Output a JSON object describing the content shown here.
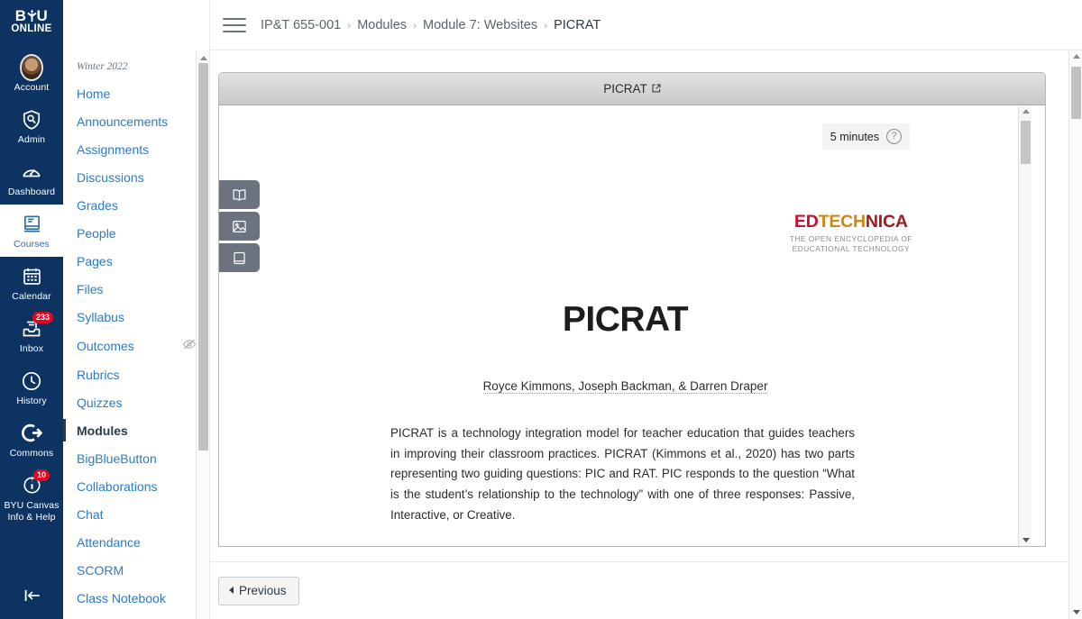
{
  "global_nav": {
    "logo": {
      "line1_pre": "B",
      "line1_mid": "Y",
      "line1_post": "U",
      "line2": "ONLINE"
    },
    "items": [
      {
        "label": "Account",
        "icon": "avatar-icon",
        "badge": null,
        "active": false
      },
      {
        "label": "Admin",
        "icon": "shield-wrench-icon",
        "badge": null,
        "active": false
      },
      {
        "label": "Dashboard",
        "icon": "dashboard-gauge-icon",
        "badge": null,
        "active": false
      },
      {
        "label": "Courses",
        "icon": "courses-book-icon",
        "badge": null,
        "active": true
      },
      {
        "label": "Calendar",
        "icon": "calendar-icon",
        "badge": null,
        "active": false
      },
      {
        "label": "Inbox",
        "icon": "inbox-tray-icon",
        "badge": "233",
        "active": false
      },
      {
        "label": "History",
        "icon": "clock-icon",
        "badge": null,
        "active": false
      },
      {
        "label": "Commons",
        "icon": "commons-arrow-icon",
        "badge": null,
        "active": false
      },
      {
        "label": "BYU Canvas Info & Help",
        "icon": "help-info-icon",
        "badge": "10",
        "active": false
      }
    ],
    "collapse_icon": "collapse-left-icon"
  },
  "course_nav": {
    "term": "Winter 2022",
    "items": [
      {
        "label": "Home",
        "active": false,
        "hidden": false
      },
      {
        "label": "Announcements",
        "active": false,
        "hidden": false
      },
      {
        "label": "Assignments",
        "active": false,
        "hidden": false
      },
      {
        "label": "Discussions",
        "active": false,
        "hidden": false
      },
      {
        "label": "Grades",
        "active": false,
        "hidden": false
      },
      {
        "label": "People",
        "active": false,
        "hidden": false
      },
      {
        "label": "Pages",
        "active": false,
        "hidden": false
      },
      {
        "label": "Files",
        "active": false,
        "hidden": false
      },
      {
        "label": "Syllabus",
        "active": false,
        "hidden": false
      },
      {
        "label": "Outcomes",
        "active": false,
        "hidden": true
      },
      {
        "label": "Rubrics",
        "active": false,
        "hidden": false
      },
      {
        "label": "Quizzes",
        "active": false,
        "hidden": false
      },
      {
        "label": "Modules",
        "active": true,
        "hidden": false
      },
      {
        "label": "BigBlueButton",
        "active": false,
        "hidden": false
      },
      {
        "label": "Collaborations",
        "active": false,
        "hidden": false
      },
      {
        "label": "Chat",
        "active": false,
        "hidden": false
      },
      {
        "label": "Attendance",
        "active": false,
        "hidden": false
      },
      {
        "label": "SCORM",
        "active": false,
        "hidden": false
      },
      {
        "label": "Class Notebook",
        "active": false,
        "hidden": false
      }
    ]
  },
  "topbar": {
    "menu_icon": "hamburger-menu-icon",
    "breadcrumb": [
      {
        "label": "IP&T 655-001",
        "current": false
      },
      {
        "label": "Modules",
        "current": false
      },
      {
        "label": "Module 7: Websites",
        "current": false
      },
      {
        "label": "PICRAT",
        "current": true
      }
    ],
    "separator": "›"
  },
  "lti": {
    "title": "PICRAT",
    "external_icon": "external-link-icon",
    "tools": [
      {
        "name": "open-book-icon",
        "title": "Read"
      },
      {
        "name": "image-icon",
        "title": "Figures"
      },
      {
        "name": "closed-book-icon",
        "title": "Cite"
      }
    ]
  },
  "document": {
    "minutes_label": "5 minutes",
    "help_icon": "question-mark-icon",
    "brand": {
      "part1": "ED",
      "part2": "TECH",
      "part3": "NICA",
      "tagline_line1": "THE OPEN ENCYCLOPEDIA OF",
      "tagline_line2": "EDUCATIONAL TECHNOLOGY",
      "color1": "#C8102E",
      "color2": "#CF8711",
      "color3": "#9E1B20"
    },
    "title": "PICRAT",
    "authors": "Royce Kimmons, Joseph Backman, & Darren Draper",
    "paragraph": "PICRAT is a technology integration model for teacher education that guides teachers in improving their classroom practices. PICRAT (Kimmons et al., 2020) has two parts representing two guiding questions: PIC and RAT. PIC responds to the question “What is the student’s relationship to the technology” with one of three responses: Passive, Interactive, or Creative."
  },
  "bottom_nav": {
    "previous_label": "Previous",
    "previous_arrow": "triangle-left-icon"
  },
  "colors": {
    "brand_navy": "#0c3361",
    "link_blue": "#2b7ac5",
    "badge_red": "#e0061f",
    "text_dark": "#2d3b45"
  }
}
